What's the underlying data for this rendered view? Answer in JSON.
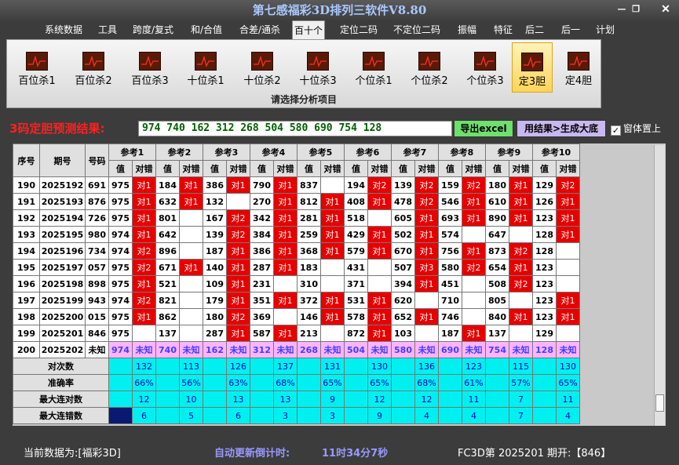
{
  "app": {
    "title": "第七感福彩3D排列三软件V8.80"
  },
  "menu": [
    "系统数据",
    "工具",
    "跨度/复式",
    "和/合值",
    "合差/通杀",
    "百十个",
    "定位二码",
    "不定位二码",
    "振幅",
    "特征",
    "后二",
    "后一",
    "计划"
  ],
  "menu_active": 5,
  "ribbon": {
    "buttons": [
      "百位杀1",
      "百位杀2",
      "百位杀3",
      "十位杀1",
      "十位杀2",
      "十位杀3",
      "个位杀1",
      "个位杀2",
      "个位杀3",
      "定3胆",
      "定4胆"
    ],
    "active_index": 9,
    "caption": "请选择分析项目"
  },
  "result": {
    "label": "3码定胆预测结果:",
    "value": "974 740 162 312 268 504 580 690 754 128",
    "export_label": "导出excel",
    "gen_label": "用结果>生成大底",
    "topmost_label": "窗体置上",
    "topmost_checked": true
  },
  "table": {
    "col_seq": "序号",
    "col_period": "期号",
    "col_code": "号码",
    "ref_headers": [
      "参考1",
      "参考2",
      "参考3",
      "参考4",
      "参考5",
      "参考6",
      "参考7",
      "参考8",
      "参考9",
      "参考10"
    ],
    "sub_val": "值",
    "sub_hit": "对错",
    "rows": [
      {
        "seq": "190",
        "period": "2025192",
        "code": "691",
        "cells": [
          [
            "975",
            "对1"
          ],
          [
            "184",
            "对1"
          ],
          [
            "386",
            "对1"
          ],
          [
            "790",
            "对1"
          ],
          [
            "837",
            ""
          ],
          [
            "194",
            "对2"
          ],
          [
            "139",
            "对2"
          ],
          [
            "159",
            "对2"
          ],
          [
            "180",
            "对1"
          ],
          [
            "129",
            "对2"
          ]
        ]
      },
      {
        "seq": "191",
        "period": "2025193",
        "code": "876",
        "cells": [
          [
            "975",
            "对1"
          ],
          [
            "632",
            "对1"
          ],
          [
            "132",
            ""
          ],
          [
            "270",
            "对1"
          ],
          [
            "812",
            "对1"
          ],
          [
            "408",
            "对1"
          ],
          [
            "478",
            "对2"
          ],
          [
            "546",
            "对1"
          ],
          [
            "610",
            "对1"
          ],
          [
            "126",
            "对1"
          ]
        ]
      },
      {
        "seq": "192",
        "period": "2025194",
        "code": "726",
        "cells": [
          [
            "975",
            "对1"
          ],
          [
            "801",
            ""
          ],
          [
            "167",
            "对2"
          ],
          [
            "342",
            "对1"
          ],
          [
            "281",
            "对1"
          ],
          [
            "518",
            ""
          ],
          [
            "605",
            "对1"
          ],
          [
            "693",
            "对1"
          ],
          [
            "890",
            "对1"
          ],
          [
            "123",
            "对1"
          ]
        ]
      },
      {
        "seq": "193",
        "period": "2025195",
        "code": "980",
        "cells": [
          [
            "974",
            "对1"
          ],
          [
            "642",
            ""
          ],
          [
            "139",
            "对2"
          ],
          [
            "384",
            "对1"
          ],
          [
            "259",
            "对1"
          ],
          [
            "429",
            "对1"
          ],
          [
            "502",
            "对1"
          ],
          [
            "574",
            ""
          ],
          [
            "647",
            ""
          ],
          [
            "128",
            "对1"
          ]
        ]
      },
      {
        "seq": "194",
        "period": "2025196",
        "code": "734",
        "cells": [
          [
            "974",
            "对2"
          ],
          [
            "896",
            ""
          ],
          [
            "187",
            "对1"
          ],
          [
            "386",
            "对1"
          ],
          [
            "368",
            "对1"
          ],
          [
            "579",
            "对1"
          ],
          [
            "670",
            "对1"
          ],
          [
            "756",
            "对1"
          ],
          [
            "873",
            "对2"
          ],
          [
            "128",
            ""
          ]
        ]
      },
      {
        "seq": "195",
        "period": "2025197",
        "code": "057",
        "cells": [
          [
            "975",
            "对2"
          ],
          [
            "671",
            "对1"
          ],
          [
            "140",
            "对1"
          ],
          [
            "287",
            "对1"
          ],
          [
            "183",
            ""
          ],
          [
            "431",
            ""
          ],
          [
            "507",
            "对3"
          ],
          [
            "580",
            "对2"
          ],
          [
            "654",
            "对1"
          ],
          [
            "123",
            ""
          ]
        ]
      },
      {
        "seq": "196",
        "period": "2025198",
        "code": "898",
        "cells": [
          [
            "975",
            "对1"
          ],
          [
            "521",
            ""
          ],
          [
            "109",
            "对1"
          ],
          [
            "231",
            ""
          ],
          [
            "310",
            ""
          ],
          [
            "371",
            ""
          ],
          [
            "394",
            "对1"
          ],
          [
            "451",
            ""
          ],
          [
            "508",
            "对2"
          ],
          [
            "123",
            ""
          ]
        ]
      },
      {
        "seq": "197",
        "period": "2025199",
        "code": "943",
        "cells": [
          [
            "974",
            "对2"
          ],
          [
            "821",
            ""
          ],
          [
            "179",
            "对1"
          ],
          [
            "351",
            "对1"
          ],
          [
            "372",
            "对1"
          ],
          [
            "531",
            "对1"
          ],
          [
            "620",
            ""
          ],
          [
            "710",
            ""
          ],
          [
            "805",
            ""
          ],
          [
            "123",
            "对1"
          ]
        ]
      },
      {
        "seq": "198",
        "period": "2025200",
        "code": "015",
        "cells": [
          [
            "975",
            "对1"
          ],
          [
            "862",
            ""
          ],
          [
            "180",
            "对2"
          ],
          [
            "369",
            ""
          ],
          [
            "146",
            "对1"
          ],
          [
            "578",
            "对1"
          ],
          [
            "652",
            "对1"
          ],
          [
            "746",
            ""
          ],
          [
            "840",
            "对1"
          ],
          [
            "123",
            "对1"
          ]
        ]
      },
      {
        "seq": "199",
        "period": "2025201",
        "code": "846",
        "cells": [
          [
            "975",
            ""
          ],
          [
            "137",
            ""
          ],
          [
            "287",
            "对1"
          ],
          [
            "587",
            "对1"
          ],
          [
            "213",
            ""
          ],
          [
            "872",
            "对1"
          ],
          [
            "103",
            ""
          ],
          [
            "187",
            "对1"
          ],
          [
            "137",
            ""
          ],
          [
            "129",
            ""
          ]
        ]
      }
    ],
    "forecast": {
      "seq": "200",
      "period": "2025202",
      "code": "未知",
      "cells": [
        [
          "974",
          "未知"
        ],
        [
          "740",
          "未知"
        ],
        [
          "162",
          "未知"
        ],
        [
          "312",
          "未知"
        ],
        [
          "268",
          "未知"
        ],
        [
          "504",
          "未知"
        ],
        [
          "580",
          "未知"
        ],
        [
          "690",
          "未知"
        ],
        [
          "754",
          "未知"
        ],
        [
          "128",
          "未知"
        ]
      ]
    },
    "stats": [
      {
        "label": "对次数",
        "values": [
          "132",
          "113",
          "126",
          "137",
          "131",
          "130",
          "136",
          "123",
          "115",
          "130"
        ]
      },
      {
        "label": "准确率",
        "values": [
          "66%",
          "56%",
          "63%",
          "68%",
          "65%",
          "65%",
          "68%",
          "61%",
          "57%",
          "65%"
        ]
      },
      {
        "label": "最大连对数",
        "values": [
          "12",
          "10",
          "13",
          "13",
          "9",
          "12",
          "12",
          "11",
          "7",
          "11"
        ]
      },
      {
        "label": "最大连错数",
        "values": [
          "6",
          "5",
          "6",
          "3",
          "3",
          "9",
          "4",
          "4",
          "7",
          "4"
        ]
      }
    ]
  },
  "status": {
    "current_label": "当前数据为:[福彩3D]",
    "countdown_label": "自动更新倒计时:",
    "countdown_value": "11时34分7秒",
    "period_info": "FC3D第 2025201 期开:【846】"
  },
  "colors": {
    "hit": "#e60000",
    "forecast": "#ffb4ff",
    "stats": "#00f0f0",
    "red_label": "#ff2020"
  }
}
